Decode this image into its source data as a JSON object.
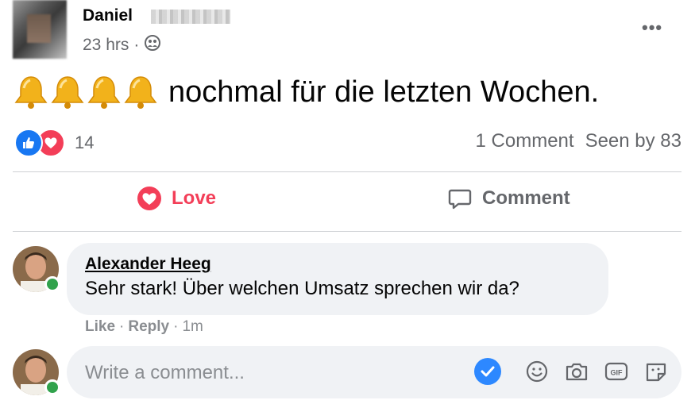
{
  "post": {
    "author": "Daniel",
    "time": "23 hrs",
    "separator": "·",
    "menu_label": "•••",
    "text": "nochmal für die letzten Wochen.",
    "emoji_icons": [
      "bell-icon",
      "bell-icon",
      "bell-icon",
      "bell-icon"
    ]
  },
  "reactions": {
    "count": "14",
    "icons": [
      "like-icon",
      "heart-icon"
    ]
  },
  "stats": {
    "comments": "1 Comment",
    "seen": "Seen by 83"
  },
  "actions": {
    "love_label": "Love",
    "comment_label": "Comment"
  },
  "comment": {
    "author": "Alexander Heeg",
    "text": "Sehr stark! Über welchen Umsatz sprechen wir da?",
    "like_label": "Like",
    "reply_label": "Reply",
    "time": "1m",
    "separator": "·"
  },
  "composer": {
    "placeholder": "Write a comment...",
    "tools": [
      "check-icon",
      "emoji-icon",
      "camera-icon",
      "gif-icon",
      "sticker-icon"
    ]
  },
  "colors": {
    "love": "#f33e58",
    "like_blue": "#1877f2",
    "muted": "#65676b",
    "online": "#31a24c",
    "bubble": "#f0f2f5"
  }
}
